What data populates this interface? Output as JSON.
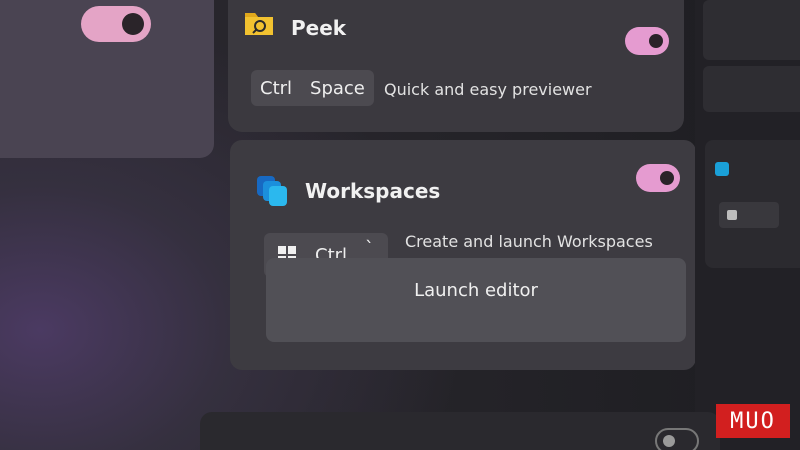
{
  "peek": {
    "title": "Peek",
    "icon": "folder-magnifier-icon",
    "keys": [
      "Ctrl",
      "Space"
    ],
    "description": "Quick and easy previewer",
    "enabled": true
  },
  "workspaces": {
    "title": "Workspaces",
    "icon": "workspaces-icon",
    "keys": [
      "Ctrl",
      "`"
    ],
    "description": "Create and launch Workspaces",
    "button_label": "Launch editor",
    "enabled": true
  },
  "watermark": "MUO",
  "colors": {
    "toggle_on": "#e59bd0",
    "accent_blue": "#1aa0d8",
    "logo_red": "#d21f1f"
  }
}
